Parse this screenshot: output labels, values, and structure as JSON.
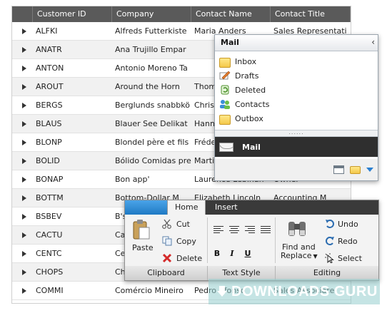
{
  "grid": {
    "columns": [
      "Customer ID",
      "Company",
      "Contact Name",
      "Contact Title"
    ],
    "rows": [
      [
        "ALFKI",
        "Alfreds Futterkiste",
        "Maria Anders",
        "Sales Representati"
      ],
      [
        "ANATR",
        "Ana Trujillo Empar",
        "",
        ""
      ],
      [
        "ANTON",
        "Antonio Moreno Ta",
        "",
        ""
      ],
      [
        "AROUT",
        "Around the Horn",
        "Thom",
        ""
      ],
      [
        "BERGS",
        "Berglunds snabbkö",
        "Chris",
        ""
      ],
      [
        "BLAUS",
        "Blauer See Delikat",
        "Hann",
        ""
      ],
      [
        "BLONP",
        "Blondel père et fils",
        "Fréde",
        ""
      ],
      [
        "BOLID",
        "Bólido Comidas pre",
        "Marti",
        ""
      ],
      [
        "BONAP",
        "Bon app'",
        "Laurence Lebihan",
        "Owner"
      ],
      [
        "BOTTM",
        "Bottom-Dollar M",
        "Elizabeth Lincoln",
        "Accounting M"
      ],
      [
        "BSBEV",
        "B's",
        "",
        ""
      ],
      [
        "CACTU",
        "Ca",
        "",
        ""
      ],
      [
        "CENTC",
        "Ce",
        "",
        ""
      ],
      [
        "CHOPS",
        "Ch",
        "",
        ""
      ],
      [
        "COMMI",
        "Comércio Mineiro",
        "Pedro Afonso",
        "Sales Associate"
      ]
    ]
  },
  "mail": {
    "title": "Mail",
    "items": [
      {
        "label": "Inbox",
        "icon": "folder-icon"
      },
      {
        "label": "Drafts",
        "icon": "drafts-icon"
      },
      {
        "label": "Deleted",
        "icon": "deleted-icon"
      },
      {
        "label": "Contacts",
        "icon": "contacts-icon"
      },
      {
        "label": "Outbox",
        "icon": "folder-icon"
      }
    ],
    "bar_label": "Mail"
  },
  "ribbon": {
    "tabs": [
      "Home",
      "Insert"
    ],
    "clipboard": {
      "paste": "Paste",
      "cut": "Cut",
      "copy": "Copy",
      "delete": "Delete",
      "label": "Clipboard"
    },
    "text_style": {
      "bold": "B",
      "italic": "I",
      "underline": "U",
      "label": "Text Style"
    },
    "editing": {
      "find_line1": "Find and",
      "find_line2": "Replace",
      "undo": "Undo",
      "redo": "Redo",
      "select": "Select",
      "label": "Editing"
    }
  },
  "watermark": {
    "text": "DOWNLOADS GURU"
  },
  "colors": {
    "header": "#5a5a5a",
    "accent": "#1f7ac4",
    "mail_bar": "#2f2f2f"
  }
}
